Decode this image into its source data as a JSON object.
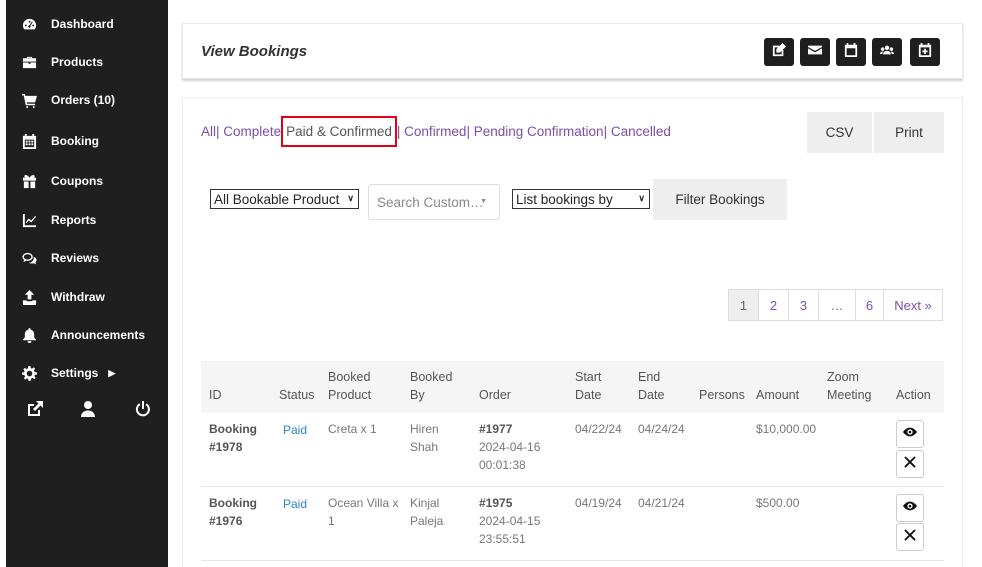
{
  "sidebar": {
    "items": [
      {
        "label": "Dashboard",
        "icon": "dashboard-icon"
      },
      {
        "label": "Products",
        "icon": "briefcase-icon"
      },
      {
        "label": "Orders (10)",
        "icon": "cart-icon"
      },
      {
        "label": "Booking",
        "icon": "calendar-icon"
      },
      {
        "label": "Coupons",
        "icon": "gift-icon"
      },
      {
        "label": "Reports",
        "icon": "chart-icon"
      },
      {
        "label": "Reviews",
        "icon": "comments-icon"
      },
      {
        "label": "Withdraw",
        "icon": "upload-icon"
      },
      {
        "label": "Announcements",
        "icon": "bell-icon"
      },
      {
        "label": "Settings",
        "icon": "gear-icon"
      }
    ]
  },
  "header": {
    "title": "View Bookings"
  },
  "filters": {
    "all": "All",
    "complete": "Complete",
    "paid_confirmed": "Paid & Confirmed",
    "confirmed": "Confirmed",
    "pending": "Pending Confirmation",
    "cancelled": "Cancelled",
    "separator": "|"
  },
  "buttons": {
    "csv": "CSV",
    "print": "Print",
    "filter": "Filter Bookings"
  },
  "controls": {
    "product_select": "All Bookable Product",
    "customer_search": "Search Custom…",
    "list_by_select": "List bookings by"
  },
  "pagination": {
    "pages": [
      "1",
      "2",
      "3",
      "…",
      "6"
    ],
    "next": "Next »",
    "current": "1"
  },
  "table": {
    "headers": {
      "id": "ID",
      "status": "Status",
      "product_l1": "Booked",
      "product_l2": "Product",
      "by_l1": "Booked",
      "by_l2": "By",
      "order": "Order",
      "start_l1": "Start",
      "start_l2": "Date",
      "end_l1": "End",
      "end_l2": "Date",
      "persons": "Persons",
      "amount": "Amount",
      "zoom_l1": "Zoom",
      "zoom_l2": "Meeting",
      "action": "Action"
    },
    "rows": [
      {
        "id_l1": "Booking",
        "id_l2": "#1978",
        "status": "Paid",
        "product_l1": "Creta x 1",
        "product_l2": "",
        "by_l1": "Hiren",
        "by_l2": "Shah",
        "order_no": "#1977",
        "order_date": "2024-04-16",
        "order_time": "00:01:38",
        "start": "04/22/24",
        "end": "04/24/24",
        "persons": "",
        "amount": "$10,000.00",
        "zoom": ""
      },
      {
        "id_l1": "Booking",
        "id_l2": "#1976",
        "status": "Paid",
        "product_l1": "Ocean Villa x",
        "product_l2": "1",
        "by_l1": "Kinjal",
        "by_l2": "Paleja",
        "order_no": "#1975",
        "order_date": "2024-04-15",
        "order_time": "23:55:51",
        "start": "04/19/24",
        "end": "04/21/24",
        "persons": "",
        "amount": "$500.00",
        "zoom": ""
      }
    ]
  }
}
